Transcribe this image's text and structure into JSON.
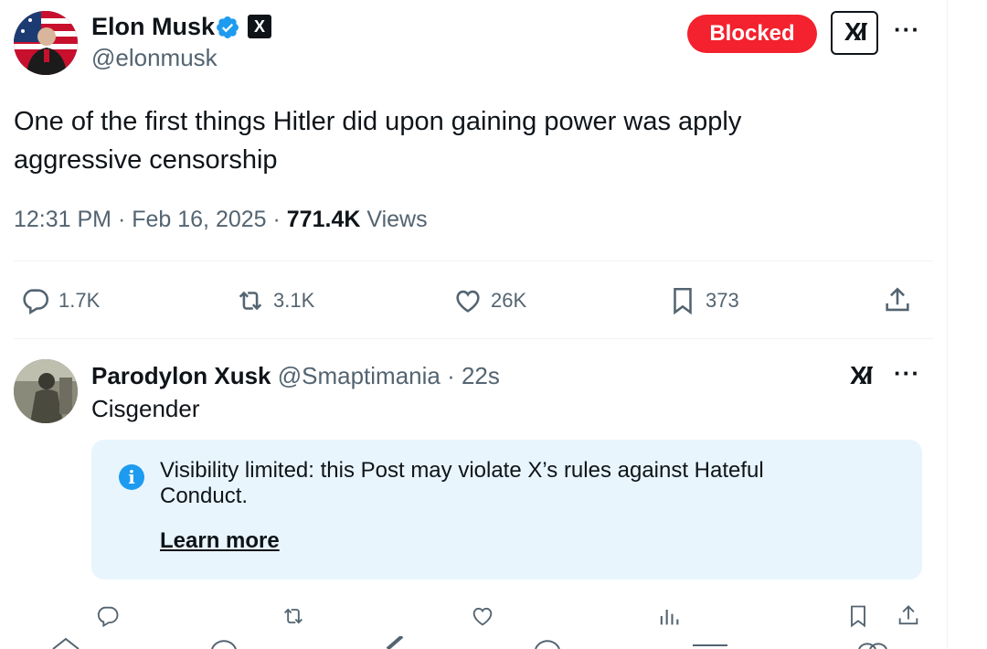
{
  "main_post": {
    "author_name": "Elon Musk",
    "author_handle": "@elonmusk",
    "x_badge": "X",
    "blocked_label": "Blocked",
    "xai_label": "X⁄I",
    "more_label": "···",
    "text": "One of the first things Hitler did upon gaining power was apply aggressive censorship",
    "time": "12:31 PM · Feb 16, 2025 · ",
    "views_count": "771.4K",
    "views_label": " Views",
    "actions": {
      "replies": "1.7K",
      "reposts": "3.1K",
      "likes": "26K",
      "bookmarks": "373"
    }
  },
  "reply": {
    "author_name": "Parodylon Xusk",
    "author_handle": "@Smaptimania · 22s",
    "text": "Cisgender",
    "xai_label": "X⁄I",
    "more_label": "···",
    "notice_text": "Visibility limited: this Post may violate X’s rules against Hateful Conduct.",
    "info_glyph": "i",
    "learn_more": "Learn more"
  },
  "colors": {
    "blocked": "#f4212e",
    "verified": "#1d9bf0",
    "notice_bg": "#e8f5fd",
    "secondary_text": "#536471"
  },
  "icons": [
    "verified-icon",
    "reply-icon",
    "repost-icon",
    "like-icon",
    "bookmark-icon",
    "share-icon",
    "views-icon",
    "info-icon"
  ]
}
